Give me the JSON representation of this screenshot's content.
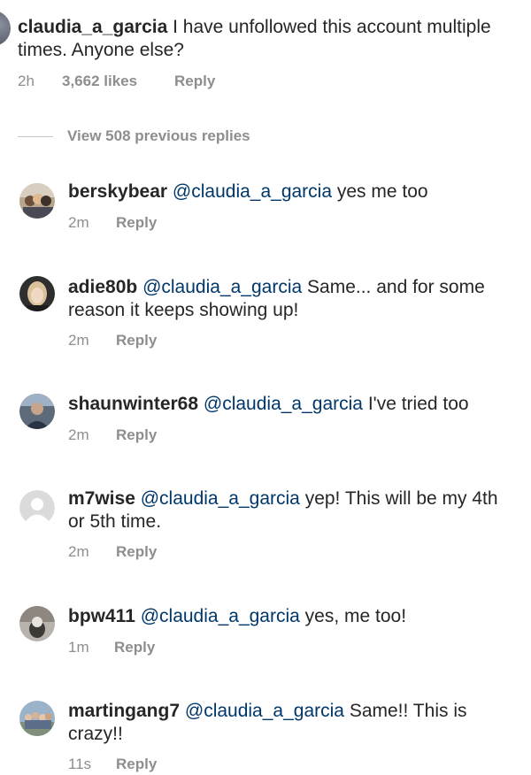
{
  "top_comment": {
    "username": "claudia_a_garcia",
    "text": "I have unfollowed this account multiple times. Anyone else?",
    "time": "2h",
    "likes": "3,662 likes",
    "reply_label": "Reply"
  },
  "view_replies": {
    "label": "View 508 previous replies"
  },
  "replies": [
    {
      "username": "berskybear",
      "mention": "@claudia_a_garcia",
      "text": "yes me too",
      "time": "2m",
      "reply_label": "Reply",
      "avatar_icon": "group-photo-avatar"
    },
    {
      "username": "adie80b",
      "mention": "@claudia_a_garcia",
      "text": "Same... and for some reason it keeps showing up!",
      "time": "2m",
      "reply_label": "Reply",
      "avatar_icon": "portrait-photo-avatar"
    },
    {
      "username": "shaunwinter68",
      "mention": "@claudia_a_garcia",
      "text": "I've tried too",
      "time": "2m",
      "reply_label": "Reply",
      "avatar_icon": "portrait-photo-avatar"
    },
    {
      "username": "m7wise",
      "mention": "@claudia_a_garcia",
      "text": "yep! This will be my 4th or 5th time.",
      "time": "2m",
      "reply_label": "Reply",
      "avatar_icon": "default-user-avatar"
    },
    {
      "username": "bpw411",
      "mention": "@claudia_a_garcia",
      "text": "yes, me too!",
      "time": "1m",
      "reply_label": "Reply",
      "avatar_icon": "photo-avatar"
    },
    {
      "username": "martingang7",
      "mention": "@claudia_a_garcia",
      "text": "Same!! This is crazy!!",
      "time": "11s",
      "reply_label": "Reply",
      "avatar_icon": "group-photo-avatar"
    }
  ],
  "colors": {
    "text": "#262626",
    "secondary": "#8e8e8e",
    "mention": "#00376b"
  }
}
